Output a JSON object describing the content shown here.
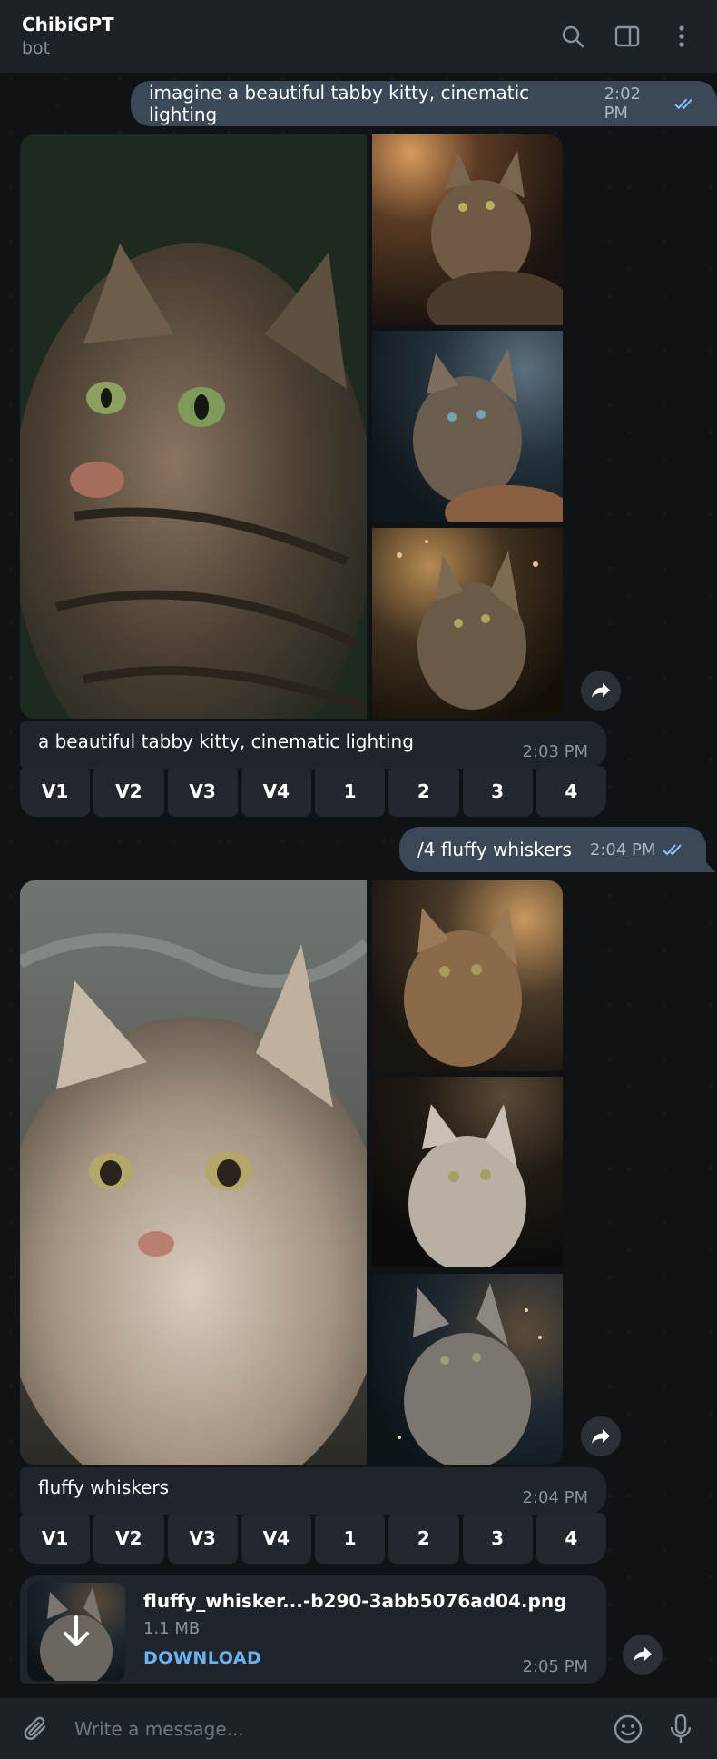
{
  "header": {
    "title": "ChibiGPT",
    "subtitle": "bot"
  },
  "messages": {
    "prompt1": {
      "text": "imagine a beautiful tabby kitty, cinematic lighting",
      "time": "2:02 PM"
    },
    "result1": {
      "caption": "a beautiful tabby kitty, cinematic lighting",
      "time": "2:03 PM",
      "buttons": [
        "V1",
        "V2",
        "V3",
        "V4",
        "1",
        "2",
        "3",
        "4"
      ]
    },
    "prompt2": {
      "text": "/4 fluffy whiskers",
      "time": "2:04 PM"
    },
    "result2": {
      "caption": "fluffy whiskers",
      "time": "2:04 PM",
      "buttons": [
        "V1",
        "V2",
        "V3",
        "V4",
        "1",
        "2",
        "3",
        "4"
      ]
    },
    "file": {
      "name": "fluffy_whisker...-b290-3abb5076ad04.png",
      "size": "1.1 MB",
      "action": "DOWNLOAD",
      "time": "2:05 PM"
    }
  },
  "composer": {
    "placeholder": "Write a message..."
  },
  "icons": {
    "header": [
      "search-icon",
      "sidebar-toggle-icon",
      "more-vertical-icon"
    ],
    "composer": [
      "attach-icon",
      "emoji-icon",
      "microphone-icon"
    ],
    "message": [
      "double-check-icon",
      "forward-icon",
      "download-arrow-icon"
    ]
  },
  "colors": {
    "header_bg": "#1d2226",
    "chat_bg": "#101315",
    "outgoing_bubble": "#3a4858",
    "incoming_bubble": "#1f252b",
    "link": "#6ab2f2",
    "read_check": "#8fc4f7"
  }
}
